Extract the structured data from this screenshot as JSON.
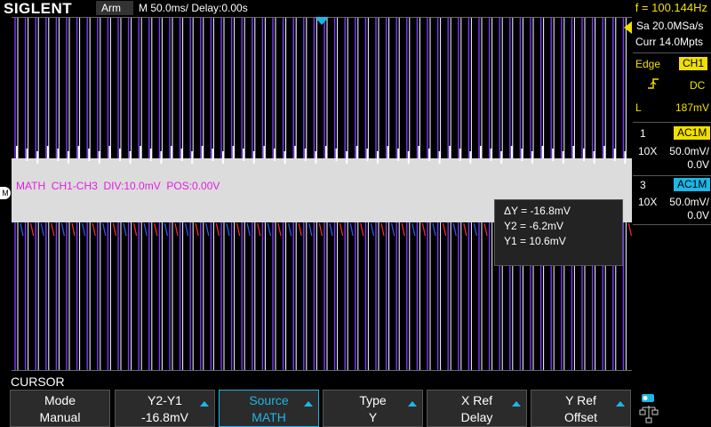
{
  "topbar": {
    "logo": "SIGLENT",
    "status": "Arm",
    "timebase": "M 50.0ms/ Delay:0.00s",
    "frequency": "f = 100.144Hz"
  },
  "acquisition": {
    "sample_rate": "Sa 20.0MSa/s",
    "memory": "Curr 14.0Mpts"
  },
  "trigger": {
    "type": "Edge",
    "source": "CH1",
    "slope_icon": "rising-edge-icon",
    "coupling": "DC",
    "level_label": "L",
    "level": "187mV"
  },
  "channels": [
    {
      "number": "1",
      "coupling": "AC1M",
      "probe": "10X",
      "scale": "50.0mV/",
      "offset": "0.0V",
      "color": "#f0e000"
    },
    {
      "number": "3",
      "coupling": "AC1M",
      "probe": "10X",
      "scale": "50.0mV/",
      "offset": "0.0V",
      "color": "#1fb6e6"
    }
  ],
  "math": {
    "label": "MATH  CH1-CH3  DIV:10.0mV  POS:0.00V",
    "marker": "M",
    "color": "#e020e0"
  },
  "cursor_readout": {
    "delta_y": "ΔY = -16.8mV",
    "y2": "Y2 = -6.2mV",
    "y1": "Y1 = 10.6mV"
  },
  "menu": {
    "title": "CURSOR",
    "softkeys": [
      {
        "top": "Mode",
        "bottom": "Manual",
        "arrow": false,
        "active": false
      },
      {
        "top": "Y2-Y1",
        "bottom": "-16.8mV",
        "arrow": true,
        "active": false
      },
      {
        "top": "Source",
        "bottom": "MATH",
        "arrow": true,
        "active": true
      },
      {
        "top": "Type",
        "bottom": "Y",
        "arrow": true,
        "active": false
      },
      {
        "top": "X Ref",
        "bottom": "Delay",
        "arrow": true,
        "active": false
      },
      {
        "top": "Y Ref",
        "bottom": "Offset",
        "arrow": true,
        "active": false
      }
    ]
  }
}
